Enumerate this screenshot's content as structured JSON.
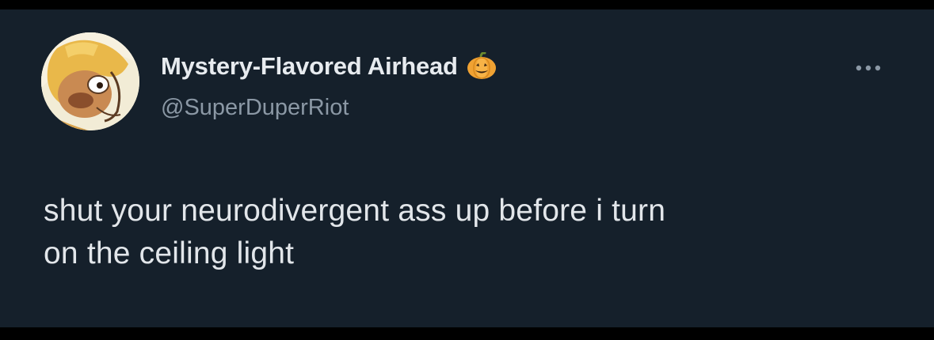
{
  "tweet": {
    "author": {
      "display_name": "Mystery-Flavored Airhead",
      "name_emoji": "pumpkin-icon",
      "handle": "@SuperDuperRiot",
      "avatar": "cartoon-character-avatar"
    },
    "menu_icon": "more-options-icon",
    "text_lines": [
      "shut your neurodivergent ass up before i turn",
      "on the ceiling light"
    ]
  },
  "colors": {
    "background": "#15202b",
    "frame": "#000000",
    "primary_text": "#e7ebef",
    "secondary_text": "#8b98a5",
    "pumpkin": "#f0a233"
  }
}
